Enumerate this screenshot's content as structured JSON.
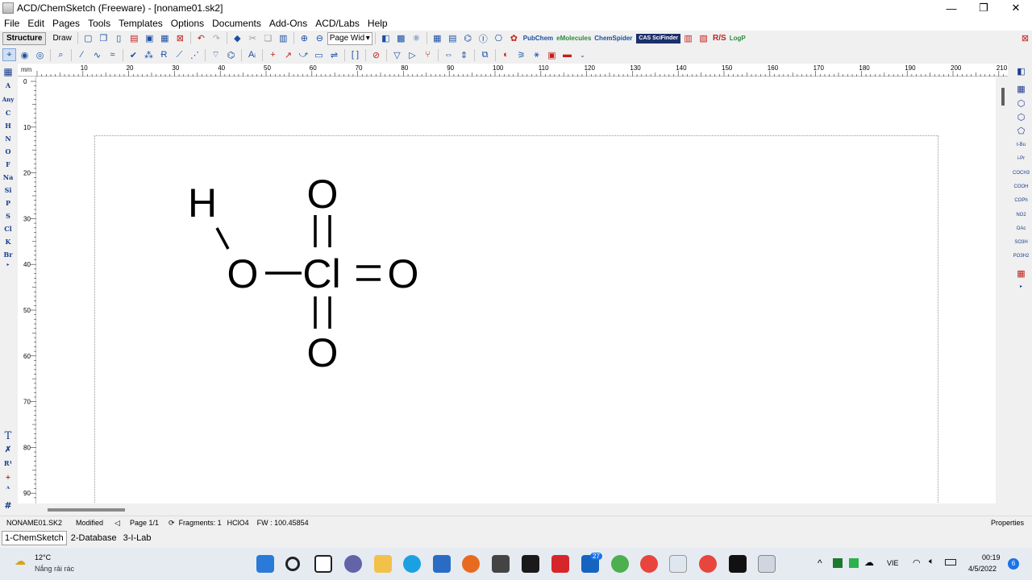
{
  "window": {
    "title": "ACD/ChemSketch (Freeware) - [noname01.sk2]",
    "minimize_glyph": "—",
    "maximize_glyph": "❐",
    "close_glyph": "✕"
  },
  "menu": [
    "File",
    "Edit",
    "Pages",
    "Tools",
    "Templates",
    "Options",
    "Documents",
    "Add-Ons",
    "ACD/Labs",
    "Help"
  ],
  "toolbar": {
    "structure_label": "Structure",
    "draw_label": "Draw",
    "zoom_value": "Page Wid",
    "pubchem_label": "PubChem",
    "emolecules_label": "eMolecules",
    "chemspider_label": "ChemSpider",
    "cas_label": "CAS SciFinder",
    "rs_label": "R/S",
    "logp_label": "LogP"
  },
  "left_palette": [
    "A",
    "Any",
    "C",
    "H",
    "N",
    "O",
    "F",
    "Na",
    "Si",
    "P",
    "S",
    "Cl",
    "K",
    "Br"
  ],
  "left_tools": [
    "T",
    "R¹",
    "+",
    "#"
  ],
  "right_palette": [
    "t-Bu",
    "i-Pr",
    "COCH3",
    "COOH",
    "COPh",
    "NO2",
    "OAc",
    "SO3H",
    "PO3H2"
  ],
  "ruler": {
    "unit": "mm",
    "h_ticks": [
      "10",
      "20",
      "30",
      "40",
      "50",
      "60",
      "70",
      "80",
      "90",
      "100",
      "110",
      "120",
      "130",
      "140",
      "150",
      "160",
      "170",
      "180",
      "190",
      "200",
      "210"
    ],
    "v_ticks": [
      "0",
      "10",
      "20",
      "30",
      "40",
      "50",
      "60",
      "70",
      "80",
      "90"
    ]
  },
  "molecule": {
    "atoms": [
      "H",
      "O",
      "Cl",
      "O",
      "O",
      "O"
    ],
    "formula": "HClO4"
  },
  "status": {
    "file": "NONAME01.SK2",
    "modified": "Modified",
    "page": "Page 1/1",
    "fragments": "Fragments: 1",
    "formula": "HClO4",
    "fw": "FW : 100.45854",
    "properties": "Properties"
  },
  "tabs": [
    "1-ChemSketch",
    "2-Database",
    "3-I-Lab"
  ],
  "taskbar": {
    "temperature": "12°C",
    "weather_text": "Nắng rải rác",
    "language": "VIE",
    "time": "00:19",
    "date": "4/5/2022",
    "notification_count": "6",
    "mail_badge": "27"
  }
}
